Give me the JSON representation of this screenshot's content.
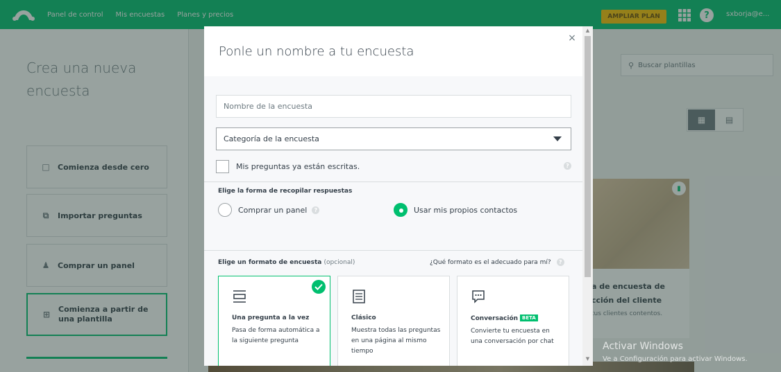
{
  "colors": {
    "brand": "#00bf6f",
    "upgrade": "#f9be00",
    "text": "#333e48",
    "muted": "#6b787f",
    "border": "#d9dddf"
  },
  "topbar": {
    "nav": [
      "Panel de control",
      "Mis encuestas",
      "Planes y precios"
    ],
    "upgrade_label": "AMPLIAR PLAN",
    "help_label": "?",
    "user": "sxborja@e..."
  },
  "left_panel": {
    "title": "Crea una nueva encuesta",
    "options": [
      {
        "label": "Comienza desde cero",
        "icon": "document-icon"
      },
      {
        "label": "Importar preguntas",
        "icon": "copy-icon"
      },
      {
        "label": "Comprar un panel",
        "icon": "people-icon"
      },
      {
        "label": "Comienza a partir de una plantilla",
        "icon": "template-icon"
      }
    ]
  },
  "right_panel": {
    "search_placeholder": "Buscar plantillas",
    "template": {
      "title": "a de encuesta de cción del cliente",
      "desc": "tus clientes contentos."
    }
  },
  "modal": {
    "title": "Ponle un nombre a tu encuesta",
    "close_label": "×",
    "name_placeholder": "Nombre de la encuesta",
    "category_value": "Categoría de la encuesta",
    "checkbox_label": "Mis preguntas ya están escritas.",
    "collect_heading": "Elige la forma de recopilar respuestas",
    "radio_options": [
      {
        "label": "Comprar un panel",
        "selected": false
      },
      {
        "label": "Usar mis propios contactos",
        "selected": true
      }
    ],
    "format_heading": "Elige un formato de encuesta",
    "format_optional": "(opcional)",
    "format_help": "¿Qué formato es el adecuado para mí?",
    "formats": [
      {
        "title": "Una pregunta a la vez",
        "desc": "Pasa de forma automática a la siguiente pregunta",
        "icon": "one-question-icon",
        "selected": true
      },
      {
        "title": "Clásico",
        "desc": "Muestra todas las preguntas en una página al mismo tiempo",
        "icon": "list-icon",
        "selected": false
      },
      {
        "title": "Conversación",
        "badge": "BETA",
        "desc": "Convierte tu encuesta en una conversación por chat",
        "icon": "chat-icon",
        "selected": false
      }
    ]
  },
  "windows_watermark": {
    "title": "Activar Windows",
    "subtitle": "Ve a Configuración para activar Windows."
  }
}
